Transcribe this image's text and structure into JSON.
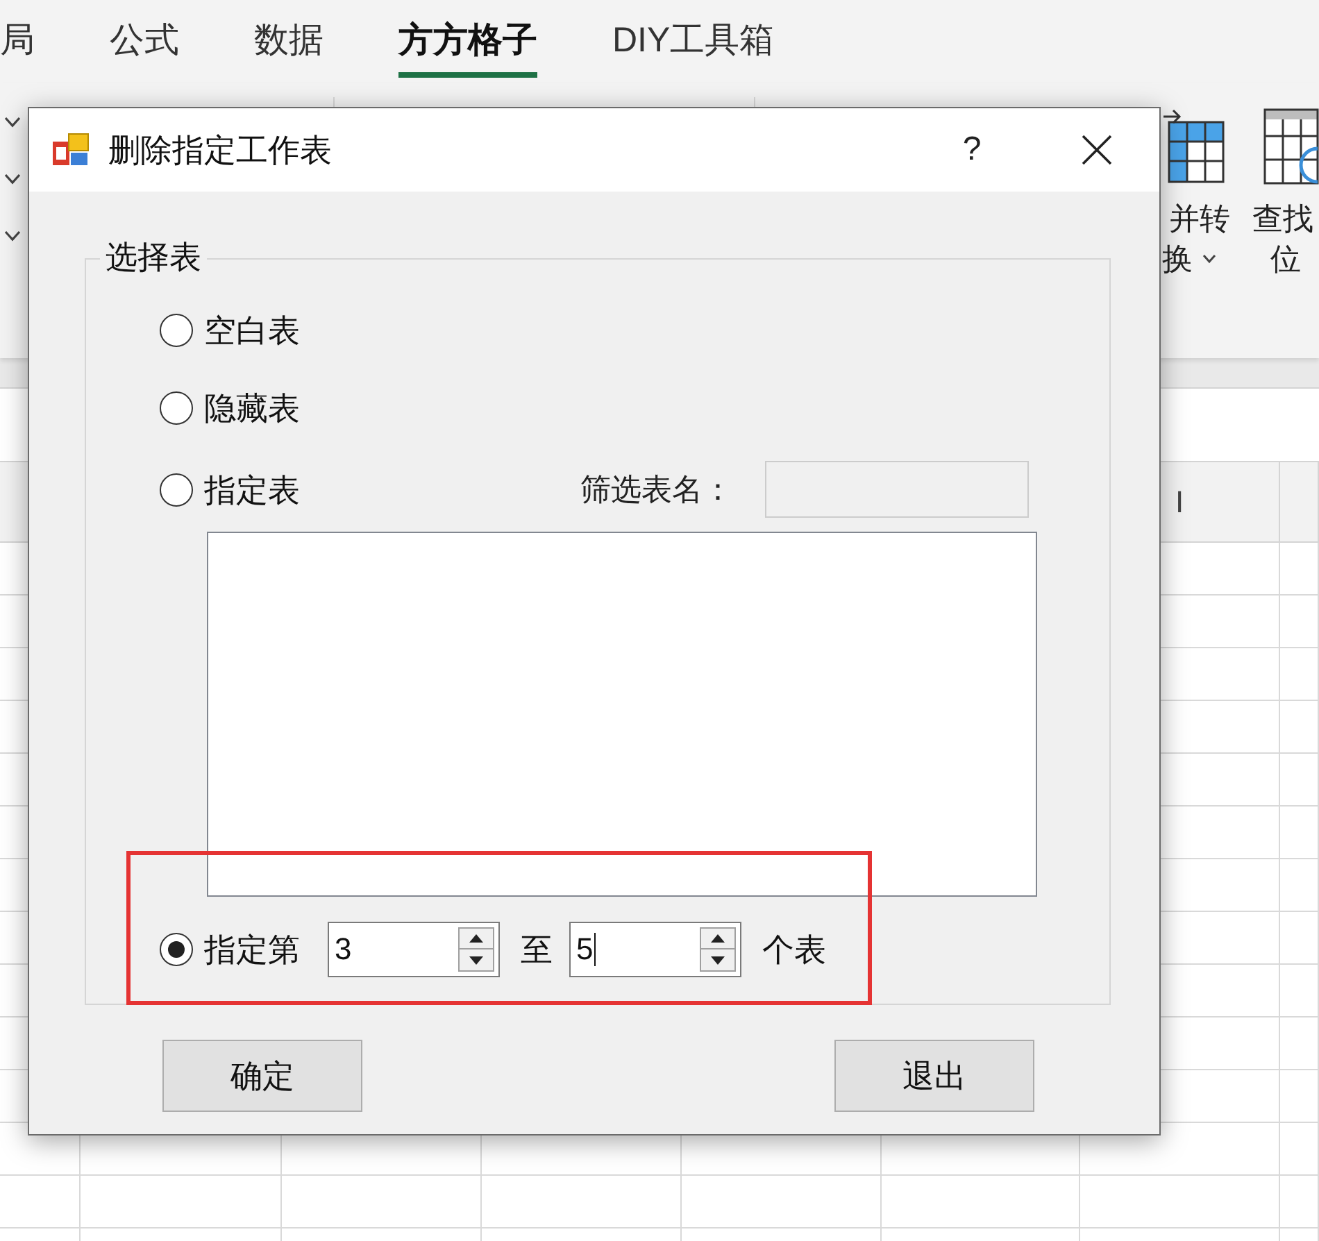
{
  "ribbon_tabs": [
    {
      "label": "局",
      "selected": false
    },
    {
      "label": "公式",
      "selected": false
    },
    {
      "label": "数据",
      "selected": false
    },
    {
      "label": "方方格子",
      "selected": true
    },
    {
      "label": "DIY工具箱",
      "selected": false
    }
  ],
  "ribbon_buttons": [
    {
      "kind": "merge",
      "lines": [
        "并转",
        "换"
      ],
      "dropdown": true
    },
    {
      "kind": "find",
      "lines": [
        "查找",
        "位"
      ]
    }
  ],
  "sheet": {
    "column_heading": "I"
  },
  "dialog": {
    "title": "删除指定工作表",
    "help": "?",
    "group_label": "选择表",
    "options": [
      {
        "kind": "plain",
        "label": "空白表",
        "selected": false
      },
      {
        "kind": "plain",
        "label": "隐藏表",
        "selected": false
      },
      {
        "kind": "filter",
        "label": "指定表",
        "selected": false,
        "filter_label": "筛选表名：",
        "filter_disabled": true
      },
      {
        "kind": "range",
        "label": "指定第",
        "selected": true,
        "from": {
          "value": "3",
          "focused": false
        },
        "between": "至",
        "to": {
          "value": "5",
          "focused": true
        },
        "suffix": "个表"
      }
    ],
    "buttons": [
      {
        "label": "确定"
      },
      {
        "label": "退出"
      }
    ]
  }
}
